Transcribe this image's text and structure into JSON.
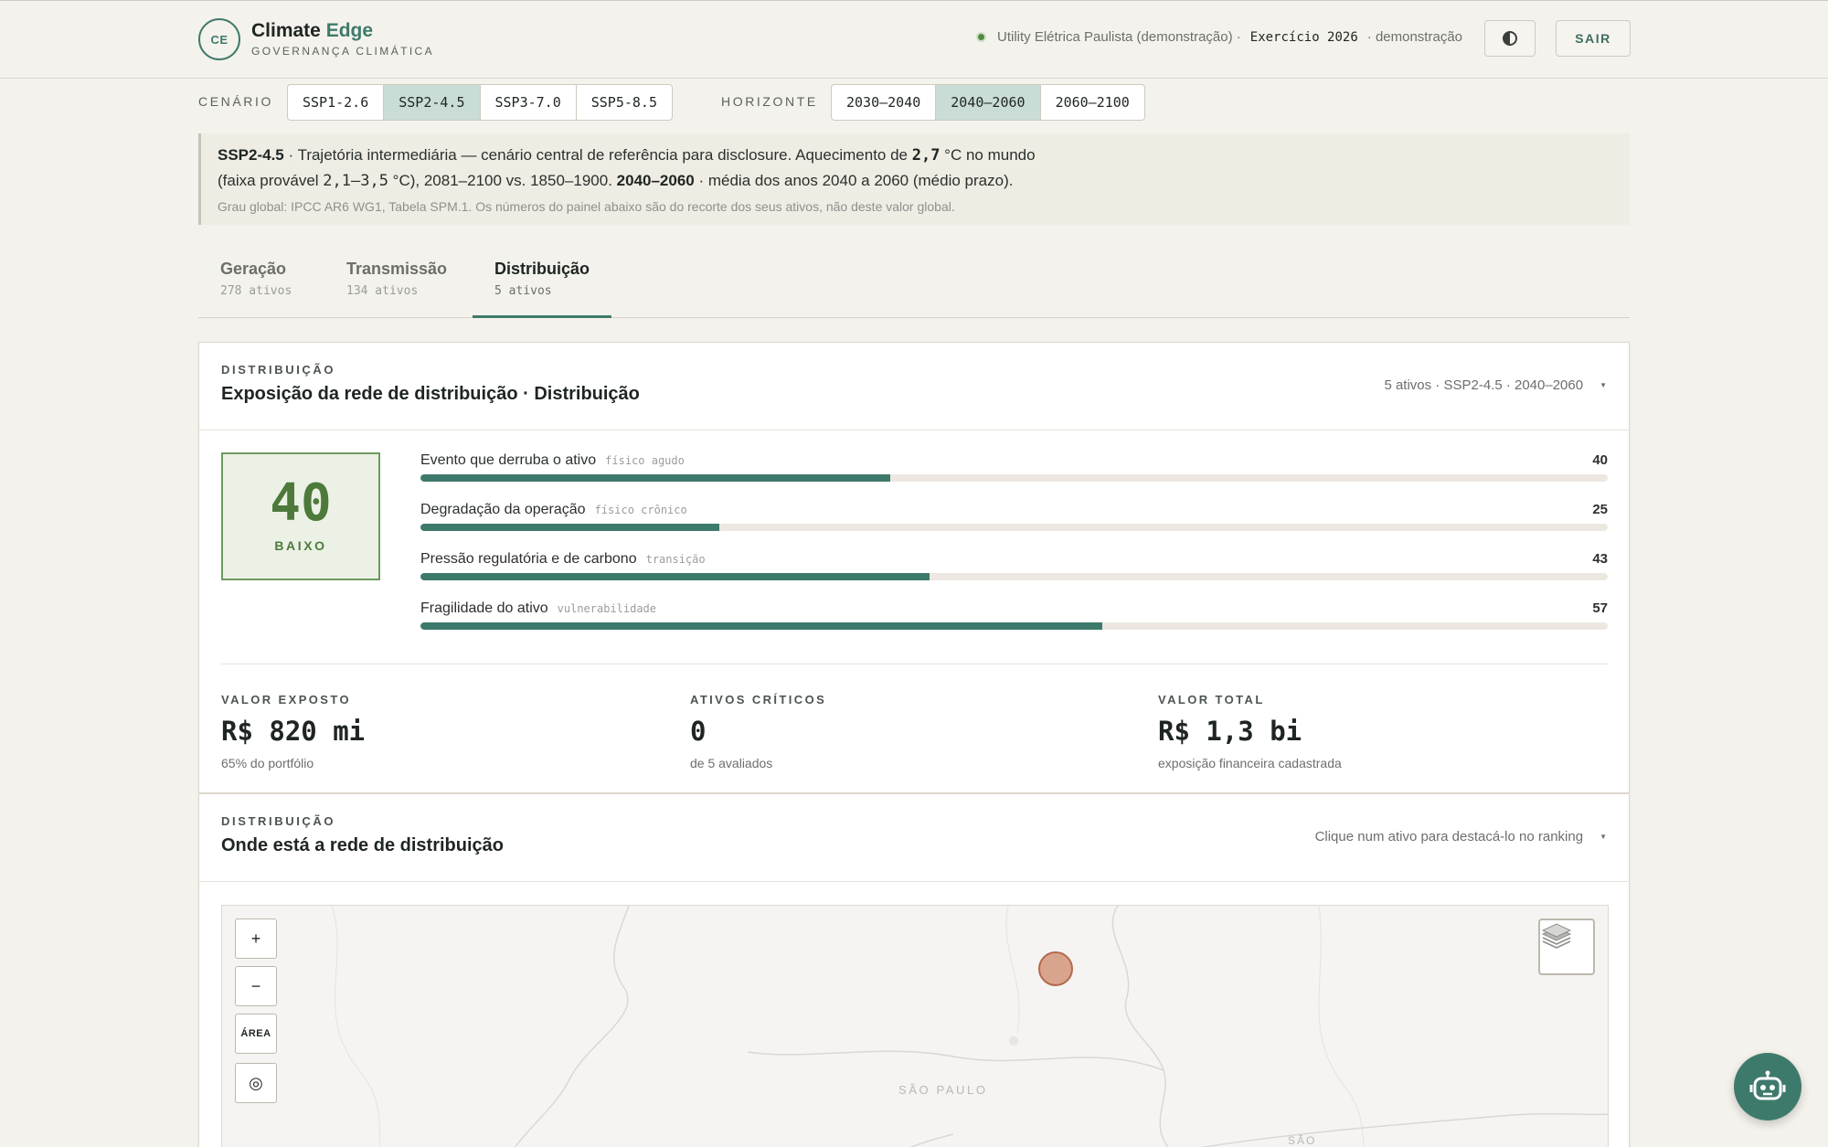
{
  "header": {
    "logo_text": "CE",
    "brand_name_1": "Climate",
    "brand_name_2": "Edge",
    "brand_sub": "GOVERNANÇA CLIMÁTICA",
    "org": "Utility Elétrica Paulista (demonstração) ·",
    "exercise": "Exercício 2026",
    "mode": "· demonstração",
    "logout_label": "SAIR"
  },
  "scenario": {
    "label": "CENÁRIO",
    "options": [
      "SSP1-2.6",
      "SSP2-4.5",
      "SSP3-7.0",
      "SSP5-8.5"
    ],
    "selected": "SSP2-4.5"
  },
  "horizon": {
    "label": "HORIZONTE",
    "options": [
      "2030–2040",
      "2040–2060",
      "2060–2100"
    ],
    "selected": "2040–2060"
  },
  "info": {
    "scenario_code": "SSP2-4.5",
    "line1_text": " · Trajetória intermediária — cenário central de referência para disclosure. Aquecimento de ",
    "warming": "2,7",
    "line1_end": " °C no mundo",
    "line2_start": "(faixa provável ",
    "range": "2,1–3,5",
    "line2_mid": " °C), 2081–2100 vs. 1850–1900. ",
    "horizon_code": "2040–2060",
    "line2_end": " · média dos anos 2040 a 2060 (médio prazo).",
    "source": "Grau global: IPCC AR6 WG1, Tabela SPM.1. Os números do painel abaixo são do recorte dos seus ativos, não deste valor global."
  },
  "tabs": [
    {
      "title": "Geração",
      "sub": "278 ativos"
    },
    {
      "title": "Transmissão",
      "sub": "134 ativos"
    },
    {
      "title": "Distribuição",
      "sub": "5 ativos"
    }
  ],
  "exposure_card": {
    "eyebrow": "DISTRIBUIÇÃO",
    "title": "Exposição da rede de distribuição · Distribuição",
    "meta": "5 ativos · SSP2-4.5 · 2040–2060",
    "score": "40",
    "score_level": "BAIXO",
    "bars": [
      {
        "label": "Evento que derruba o ativo",
        "tag": "físico agudo",
        "value": 40,
        "value_text": "40",
        "fill": 0.396
      },
      {
        "label": "Degradação da operação",
        "tag": "físico crônico",
        "value": 25,
        "value_text": "25",
        "fill": 0.252
      },
      {
        "label": "Pressão regulatória e de carbono",
        "tag": "transição",
        "value": 43,
        "value_text": "43",
        "fill": 0.429
      },
      {
        "label": "Fragilidade do ativo",
        "tag": "vulnerabilidade",
        "value": 57,
        "value_text": "57",
        "fill": 0.574
      }
    ],
    "stats": [
      {
        "label": "VALOR EXPOSTO",
        "value": "R$ 820 mi",
        "sub": "65% do portfólio"
      },
      {
        "label": "ATIVOS CRÍTICOS",
        "value": "0",
        "sub": "de 5 avaliados"
      },
      {
        "label": "VALOR TOTAL",
        "value": "R$ 1,3 bi",
        "sub": "exposição financeira cadastrada"
      }
    ]
  },
  "map_card": {
    "eyebrow": "DISTRIBUIÇÃO",
    "title": "Onde está a rede de distribuição",
    "meta": "Clique num ativo para destacá-lo no ranking",
    "zoom_in": "+",
    "zoom_out": "−",
    "area_label": "ÁREA",
    "locate_label": "◎",
    "state_label": "SÃO PAULO",
    "city_label": "SÃO"
  },
  "colors": {
    "accent": "#3e7a6b",
    "score_green": "#4d7a3a",
    "asset_marker": "#d9a48d"
  }
}
